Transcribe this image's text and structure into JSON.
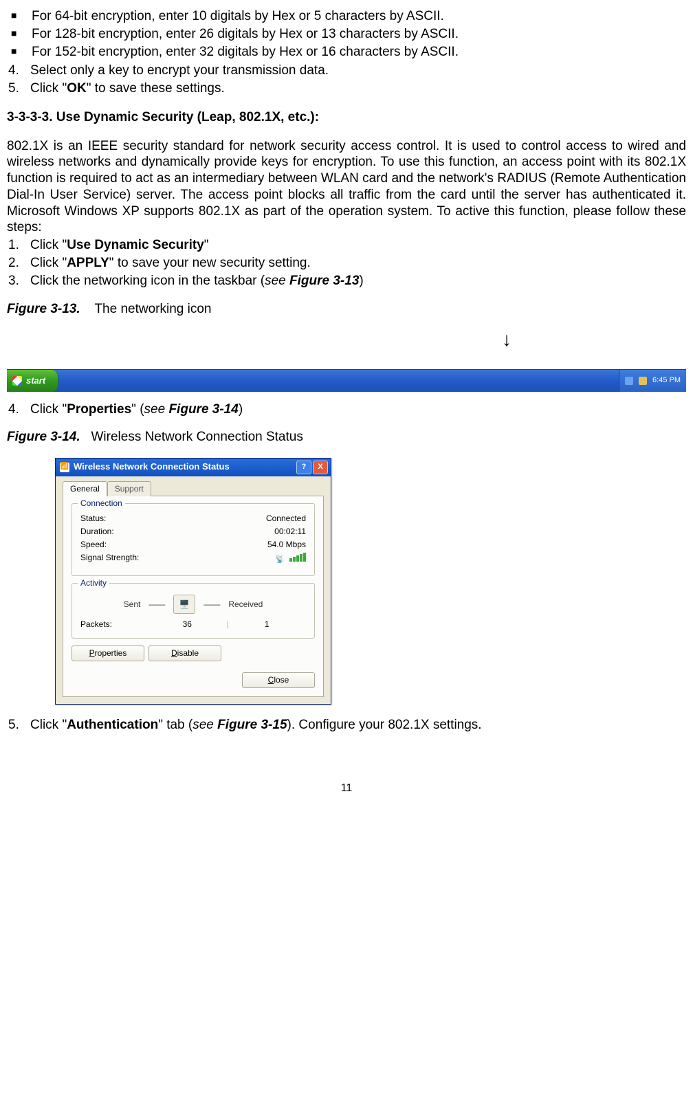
{
  "bullets": [
    "For 64-bit encryption, enter 10 digitals by Hex or 5 characters by ASCII.",
    "For 128-bit encryption, enter 26 digitals by Hex or 13 characters by ASCII.",
    "For 152-bit encryption, enter 32 digitals by Hex or 16 characters by ASCII."
  ],
  "cont_steps": {
    "n4": "4.",
    "t4": "Select only a key to encrypt your transmission data.",
    "n5": "5.",
    "t5_a": "Click \"",
    "t5_b": "OK",
    "t5_c": "\" to save these settings."
  },
  "section_heading": "3-3-3-3. Use Dynamic Security (Leap, 802.1X, etc.):",
  "para": "802.1X is an IEEE security standard for network security access control. It is used to control access to wired and wireless networks and dynamically provide keys for encryption. To use this function, an access point with its 802.1X function is required to act as an intermediary between WLAN card and the network's RADIUS (Remote Authentication Dial-In User Service) server. The access point blocks all traffic from the card until the server has authenticated it. Microsoft Windows XP supports 802.1X as part of the operation system. To active this function, please follow these steps:",
  "steps1": {
    "n1": "1.",
    "t1_a": "Click \"",
    "t1_b": "Use Dynamic Security",
    "t1_c": "\"",
    "n2": "2.",
    "t2_a": "Click \"",
    "t2_b": "APPLY",
    "t2_c": "\" to save your new security setting.",
    "n3": "3.",
    "t3_a": "Click the networking icon in the taskbar (",
    "t3_see": "see ",
    "t3_fig": "Figure 3-13",
    "t3_b": ")"
  },
  "fig13": {
    "num": "Figure 3-13.",
    "title": "The networking icon"
  },
  "taskbar": {
    "start": "start",
    "tray_time": "6:45 PM"
  },
  "step4": {
    "n": "4.",
    "a": "Click \"",
    "b": "Properties",
    "c": "\" (",
    "see": "see ",
    "fig": "Figure 3-14",
    "d": ")"
  },
  "fig14": {
    "num": "Figure 3-14.",
    "title": "Wireless Network Connection Status"
  },
  "dialog": {
    "title": "Wireless Network Connection Status",
    "help_glyph": "?",
    "close_glyph": "X",
    "tabs": {
      "general": "General",
      "support": "Support"
    },
    "group_conn": {
      "title": "Connection",
      "status_l": "Status:",
      "status_v": "Connected",
      "duration_l": "Duration:",
      "duration_v": "00:02:11",
      "speed_l": "Speed:",
      "speed_v": "54.0 Mbps",
      "signal_l": "Signal Strength:"
    },
    "group_act": {
      "title": "Activity",
      "sent": "Sent",
      "recv": "Received",
      "packets_l": "Packets:",
      "sent_v": "36",
      "recv_v": "1"
    },
    "btn_props_u": "P",
    "btn_props_rest": "roperties",
    "btn_disable_u": "D",
    "btn_disable_rest": "isable",
    "btn_close_u": "C",
    "btn_close_rest": "lose"
  },
  "step5": {
    "n": "5.",
    "a": "Click \"",
    "b": "Authentication",
    "c": "\" tab (",
    "see": "see ",
    "fig": "Figure 3-15",
    "d": "). Configure your 802.1X settings."
  },
  "page_number": "11"
}
